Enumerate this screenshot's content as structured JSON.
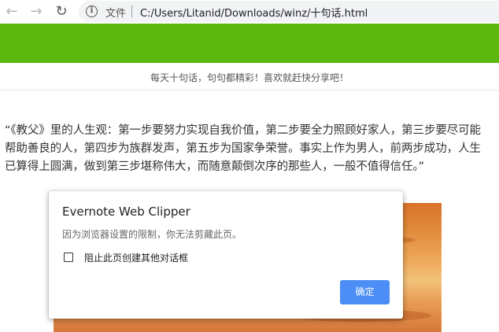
{
  "browser": {
    "back_icon": "arrow-left-icon",
    "forward_icon": "arrow-right-icon",
    "reload_icon": "reload-icon",
    "info_icon": "info-icon",
    "scheme_label": "文件",
    "url": "C:/Users/Litanid/Downloads/winz/十句话.html"
  },
  "page": {
    "header_color": "#5cb70e",
    "subtitle": "每天十句话，句句都精彩！喜欢就赶快分享吧！",
    "quote": "“《教父》里的人生观：第一步要努力实现自我价值，第二步要全力照顾好家人，第三步要尽可能帮助善良的人，第四步为族群发声，第五步为国家争荣誉。事实上作为男人，前两步成功，人生已算得上圆满，做到第三步堪称伟大，而随意颠倒次序的那些人，一般不值得信任。”"
  },
  "dialog": {
    "title": "Evernote Web Clipper",
    "message": "因为浏览器设置的限制，你无法剪藏此页。",
    "checkbox_label": "阻止此页创建其他对话框",
    "checkbox_checked": false,
    "ok_label": "确定",
    "ok_color": "#4c8ef5"
  }
}
